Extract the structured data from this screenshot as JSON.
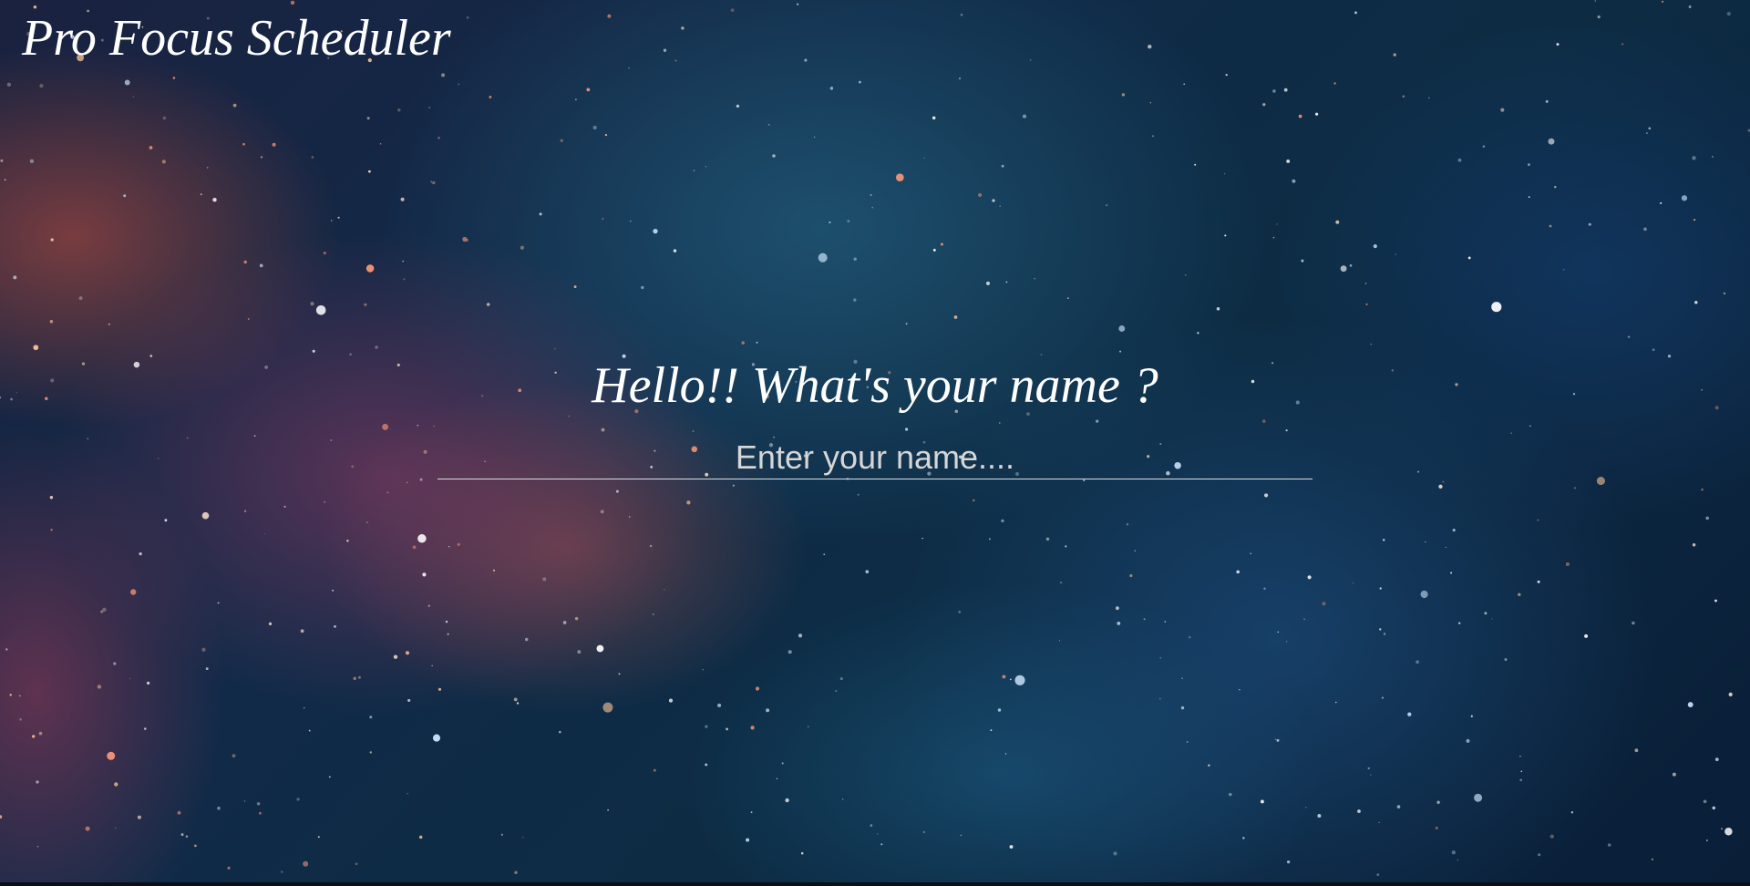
{
  "app": {
    "title": "Pro Focus Scheduler"
  },
  "prompt": {
    "question": "Hello!! What's your name ?",
    "name_placeholder": "Enter your name....",
    "name_value": ""
  },
  "theme": {
    "text_color": "#ffffff",
    "placeholder_color": "#d6d6d6",
    "underline_color": "#d8dde3"
  },
  "background": {
    "image": "starry-nebula-background"
  }
}
